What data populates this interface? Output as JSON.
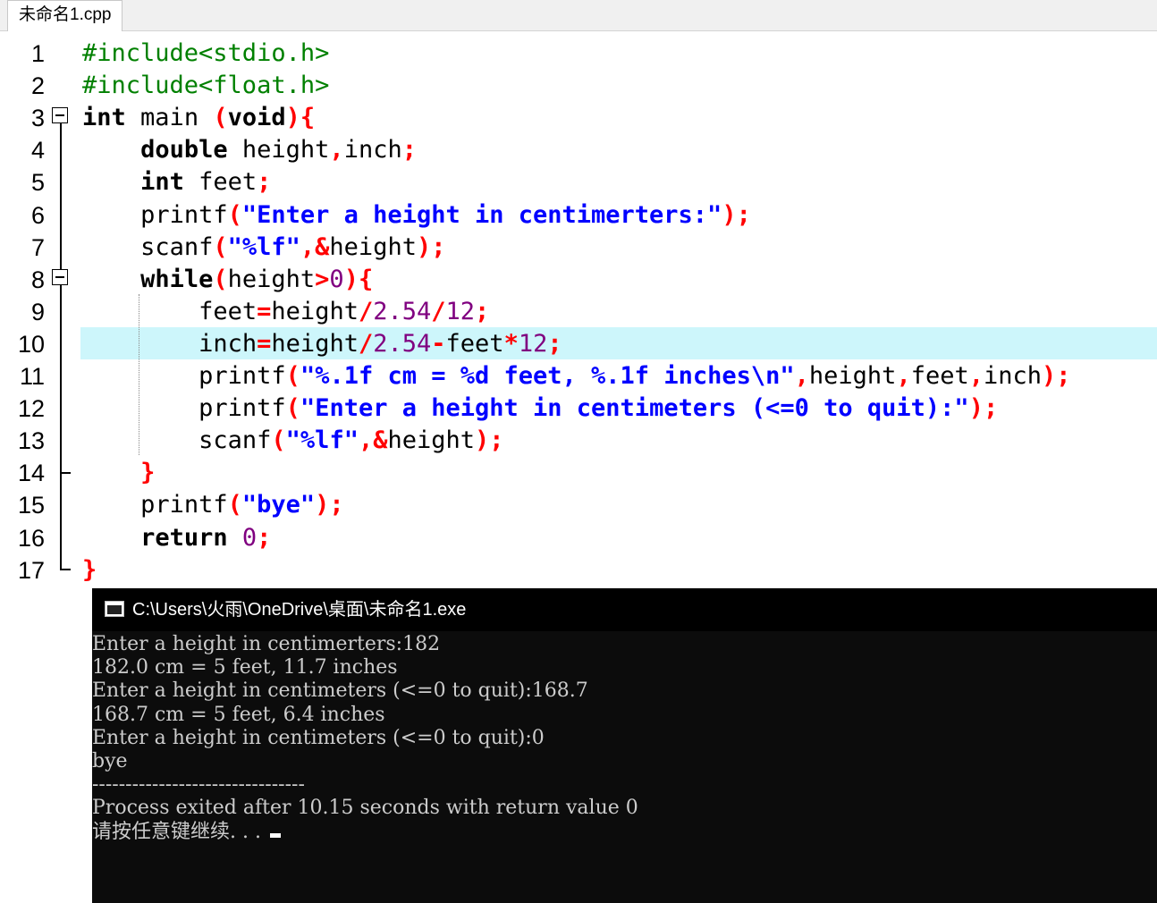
{
  "tab": {
    "filename": "未命名1.cpp"
  },
  "editor": {
    "line_numbers": [
      "1",
      "2",
      "3",
      "4",
      "5",
      "6",
      "7",
      "8",
      "9",
      "10",
      "11",
      "12",
      "13",
      "14",
      "15",
      "16",
      "17"
    ],
    "highlighted_line": "10",
    "lines": [
      "#include<stdio.h>",
      "#include<float.h>",
      "int main (void){",
      "    double height,inch;",
      "    int feet;",
      "    printf(\"Enter a height in centimerters:\");",
      "    scanf(\"%lf\",&height);",
      "    while(height>0){",
      "        feet=height/2.54/12;",
      "        inch=height/2.54-feet*12;",
      "        printf(\"%.1f cm = %d feet, %.1f inches\\n\",height,feet,inch);",
      "        printf(\"Enter a height in centimeters (<=0 to quit):\");",
      "        scanf(\"%lf\",&height);",
      "    }",
      "    printf(\"bye\");",
      "    return 0;",
      "}"
    ]
  },
  "console": {
    "title": "C:\\Users\\火雨\\OneDrive\\桌面\\未命名1.exe",
    "lines": [
      "Enter a height in centimerters:182",
      "182.0 cm = 5 feet, 11.7 inches",
      "Enter a height in centimeters (<=0 to quit):168.7",
      "168.7 cm = 5 feet, 6.4 inches",
      "Enter a height in centimeters (<=0 to quit):0",
      "bye",
      "--------------------------------",
      "Process exited after 10.15 seconds with return value 0",
      "请按任意键继续. . ."
    ]
  },
  "colors": {
    "preprocessor": "#008000",
    "keyword": "#000000",
    "operator": "#ff0000",
    "string": "#0000ff",
    "number": "#800080",
    "current_line": "#cdf6fb",
    "console_bg": "#0c0c0c",
    "console_text": "#cccccc"
  }
}
